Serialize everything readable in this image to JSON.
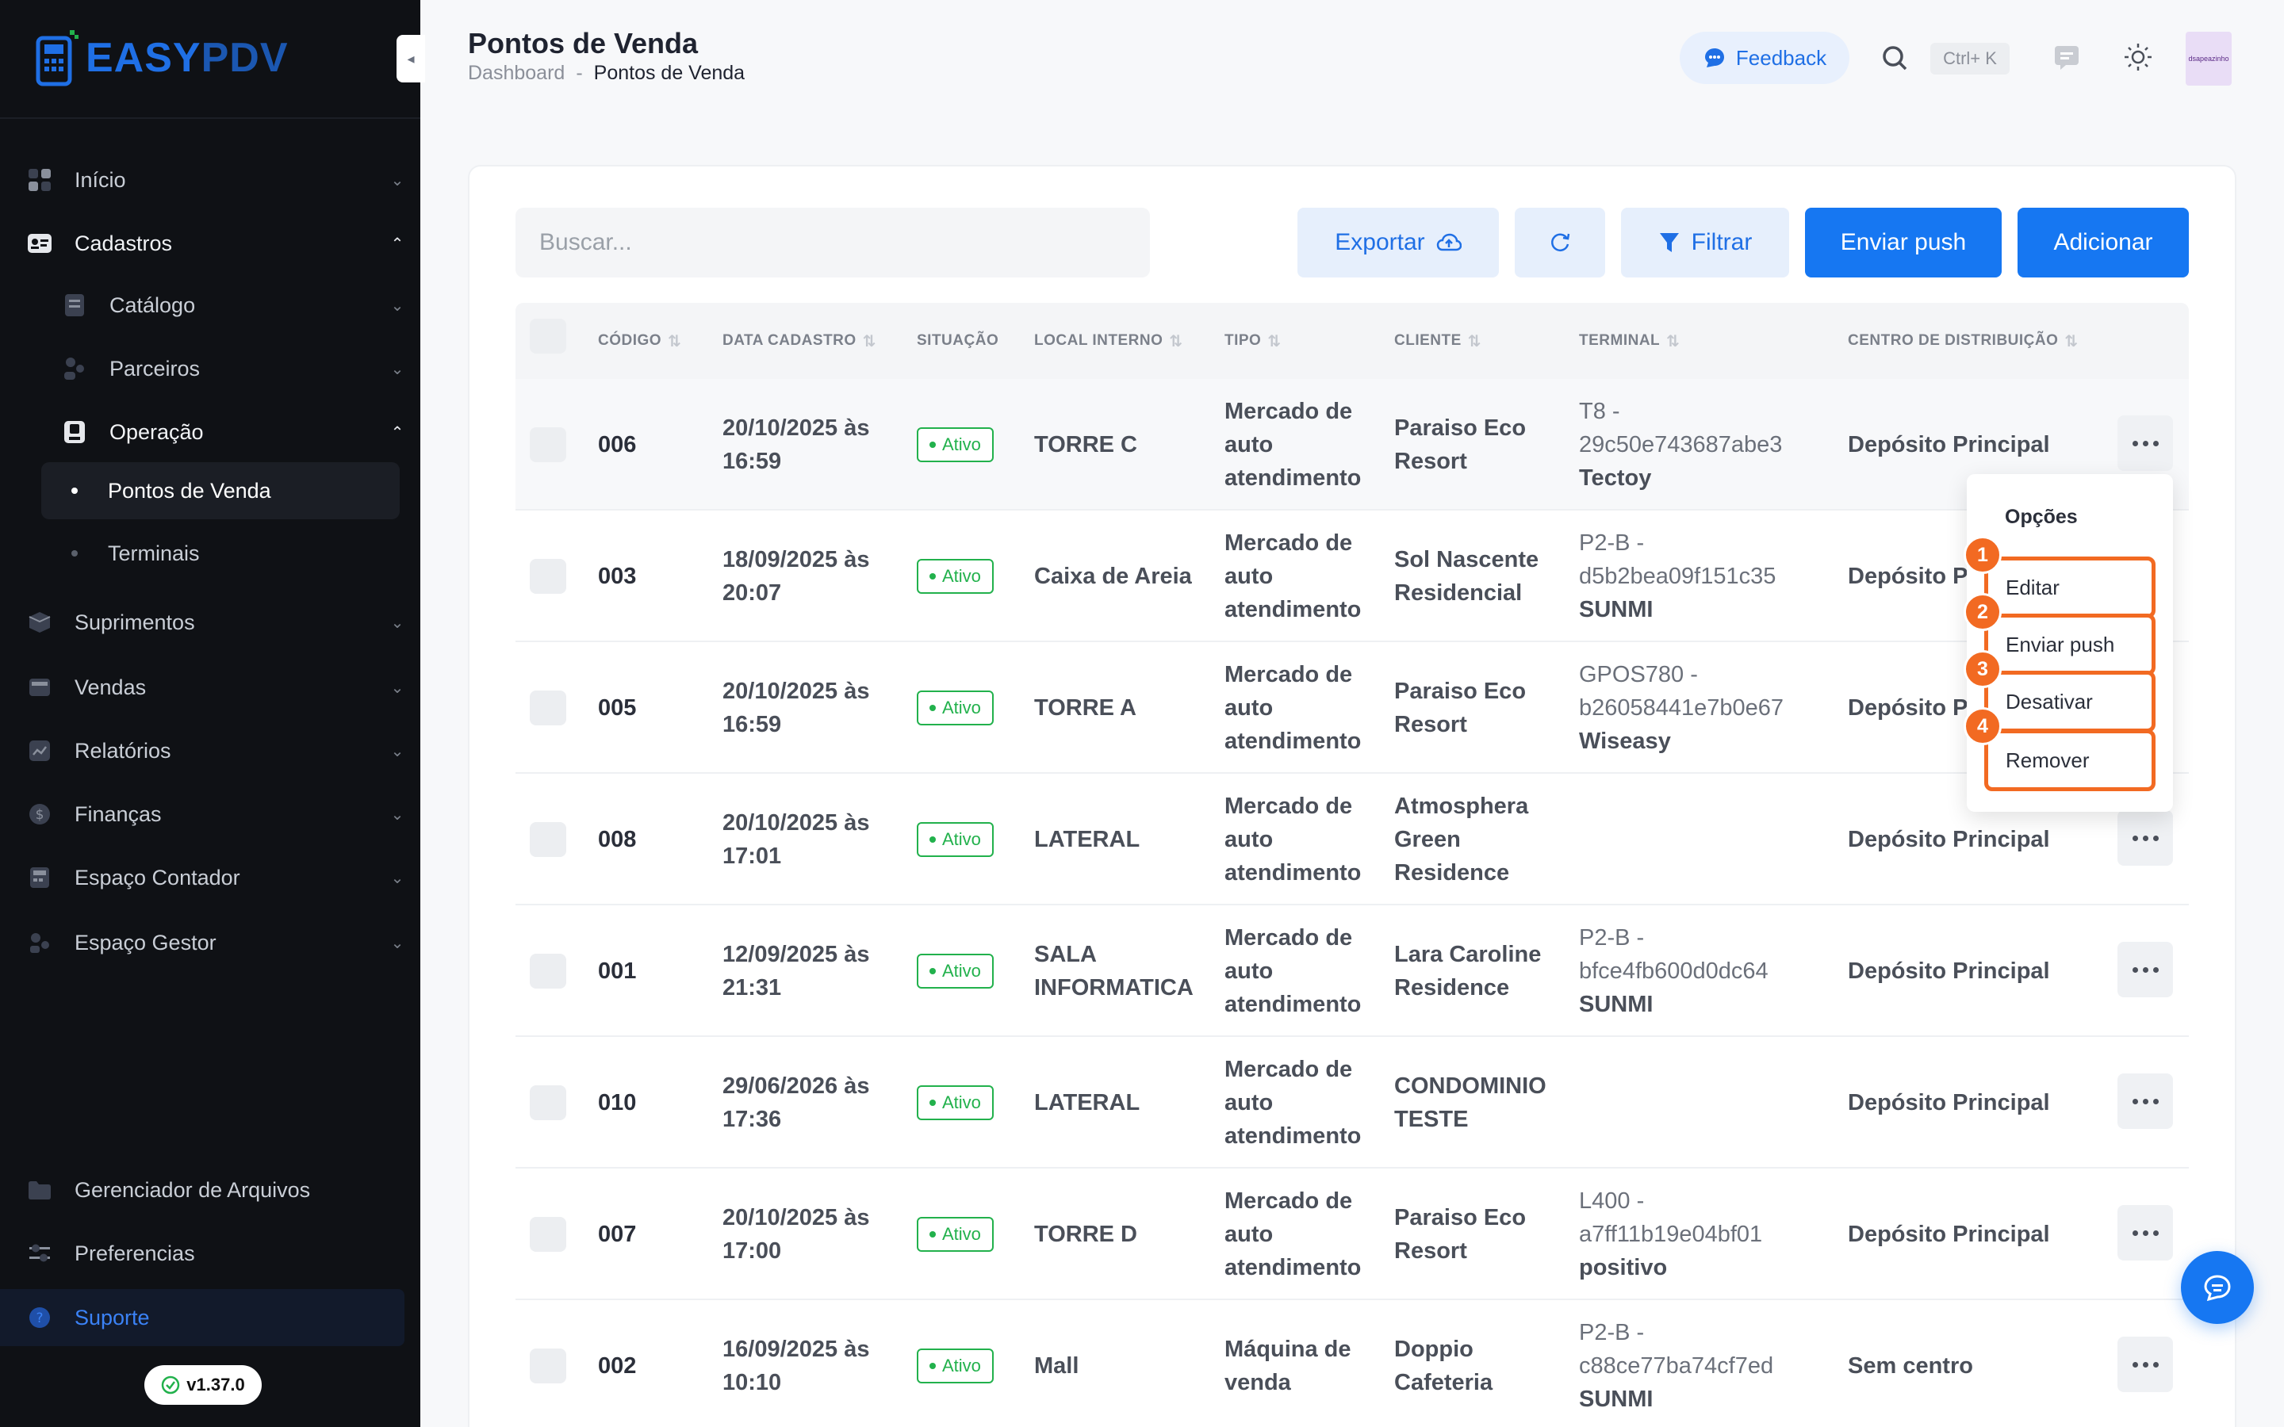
{
  "brand": {
    "name_part1": "EASY",
    "name_part2": "PDV",
    "accent": "#1f6fe5"
  },
  "sidebar": {
    "items": [
      {
        "label": "Início",
        "icon": "grid-icon"
      },
      {
        "label": "Cadastros",
        "icon": "id-card-icon"
      },
      {
        "label": "Catálogo",
        "icon": "book-icon"
      },
      {
        "label": "Parceiros",
        "icon": "users-icon"
      },
      {
        "label": "Operação",
        "icon": "device-icon"
      },
      {
        "label": "Pontos de Venda"
      },
      {
        "label": "Terminais"
      },
      {
        "label": "Suprimentos",
        "icon": "box-icon"
      },
      {
        "label": "Vendas",
        "icon": "register-icon"
      },
      {
        "label": "Relatórios",
        "icon": "chart-icon"
      },
      {
        "label": "Finanças",
        "icon": "dollar-icon"
      },
      {
        "label": "Espaço Contador",
        "icon": "calculator-icon"
      },
      {
        "label": "Espaço Gestor",
        "icon": "manager-icon"
      },
      {
        "label": "Gerenciador de Arquivos",
        "icon": "folder-icon"
      },
      {
        "label": "Preferencias",
        "icon": "sliders-icon"
      },
      {
        "label": "Suporte",
        "icon": "help-icon"
      }
    ],
    "version": "v1.37.0"
  },
  "header": {
    "title": "Pontos de Venda",
    "breadcrumb": {
      "root": "Dashboard",
      "sep": "-",
      "current": "Pontos de Venda"
    },
    "feedback_label": "Feedback",
    "shortcut": "Ctrl+ K",
    "avatar_text": "dsapeazinho"
  },
  "toolbar": {
    "search_placeholder": "Buscar...",
    "export_label": "Exportar",
    "filter_label": "Filtrar",
    "push_label": "Enviar push",
    "add_label": "Adicionar"
  },
  "table": {
    "columns": [
      "CÓDIGO",
      "DATA CADASTRO",
      "SITUAÇÃO",
      "LOCAL INTERNO",
      "TIPO",
      "CLIENTE",
      "TERMINAL",
      "CENTRO DE DISTRIBUIÇÃO"
    ],
    "rows": [
      {
        "code": "006",
        "date": "20/10/2025 às 16:59",
        "status": "Ativo",
        "local": "TORRE C",
        "type": "Mercado de auto atendimento",
        "client": "Paraiso Eco Resort",
        "terminal_id": "T8 - 29c50e743687abe3",
        "terminal_brand": "Tectoy",
        "center": "Depósito Principal"
      },
      {
        "code": "003",
        "date": "18/09/2025 às 20:07",
        "status": "Ativo",
        "local": "Caixa de Areia",
        "type": "Mercado de auto atendimento",
        "client": "Sol Nascente Residencial",
        "terminal_id": "P2-B - d5b2bea09f151c35",
        "terminal_brand": "SUNMI",
        "center": "Depósito Principal"
      },
      {
        "code": "005",
        "date": "20/10/2025 às 16:59",
        "status": "Ativo",
        "local": "TORRE A",
        "type": "Mercado de auto atendimento",
        "client": "Paraiso Eco Resort",
        "terminal_id": "GPOS780 - b26058441e7b0e67",
        "terminal_brand": "Wiseasy",
        "center": "Depósito Principal"
      },
      {
        "code": "008",
        "date": "20/10/2025 às 17:01",
        "status": "Ativo",
        "local": "LATERAL",
        "type": "Mercado de auto atendimento",
        "client": "Atmosphera Green Residence",
        "terminal_id": "",
        "terminal_brand": "",
        "center": "Depósito Principal"
      },
      {
        "code": "001",
        "date": "12/09/2025 às 21:31",
        "status": "Ativo",
        "local": "SALA INFORMATICA",
        "type": "Mercado de auto atendimento",
        "client": "Lara Caroline Residence",
        "terminal_id": "P2-B - bfce4fb600d0dc64",
        "terminal_brand": "SUNMI",
        "center": "Depósito Principal"
      },
      {
        "code": "010",
        "date": "29/06/2026 às 17:36",
        "status": "Ativo",
        "local": "LATERAL",
        "type": "Mercado de auto atendimento",
        "client": "CONDOMINIO TESTE",
        "terminal_id": "",
        "terminal_brand": "",
        "center": "Depósito Principal"
      },
      {
        "code": "007",
        "date": "20/10/2025 às 17:00",
        "status": "Ativo",
        "local": "TORRE D",
        "type": "Mercado de auto atendimento",
        "client": "Paraiso Eco Resort",
        "terminal_id": "L400 - a7ff11b19e04bf01",
        "terminal_brand": "positivo",
        "center": "Depósito Principal"
      },
      {
        "code": "002",
        "date": "16/09/2025 às 10:10",
        "status": "Ativo",
        "local": "Mall",
        "type": "Máquina de venda",
        "client": "Doppio Cafeteria",
        "terminal_id": "P2-B - c88ce77ba74cf7ed",
        "terminal_brand": "SUNMI",
        "center": "Sem centro"
      }
    ]
  },
  "menu": {
    "title": "Opções",
    "items": [
      {
        "num": "1",
        "label": "Editar"
      },
      {
        "num": "2",
        "label": "Enviar push"
      },
      {
        "num": "3",
        "label": "Desativar"
      },
      {
        "num": "4",
        "label": "Remover"
      }
    ],
    "highlight_color": "#f26a22"
  }
}
